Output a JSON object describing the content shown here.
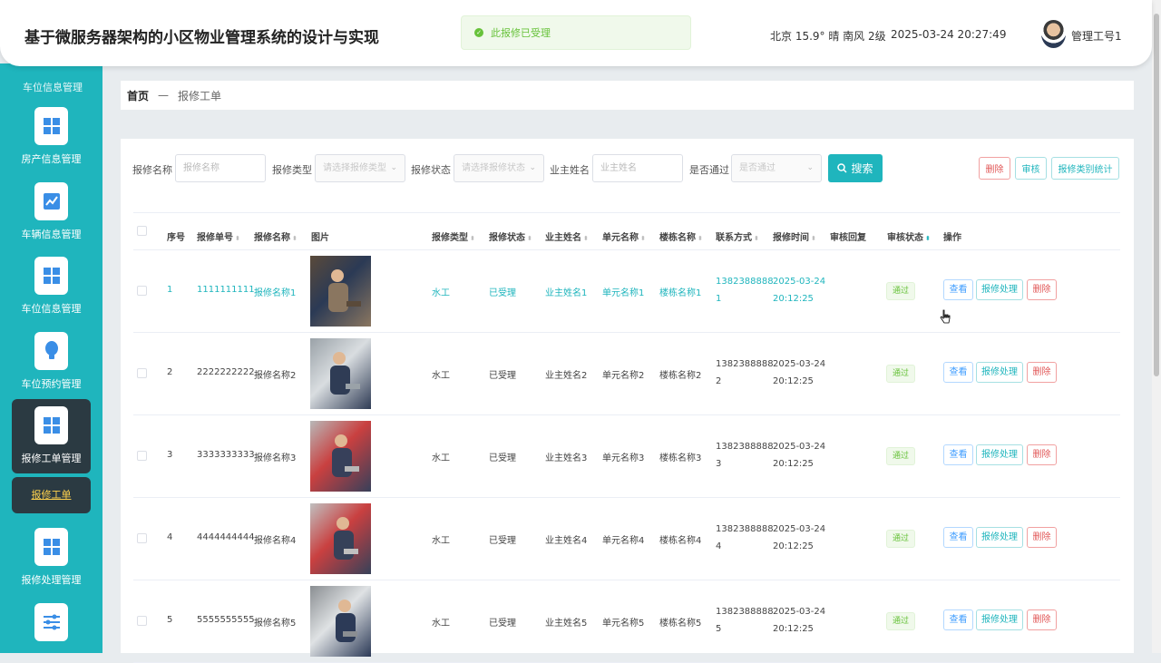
{
  "header": {
    "title": "基于微服务器架构的小区物业管理系统的设计与实现",
    "toast": "此报修已受理",
    "weather": "北京  15.9°  晴  南风  2级",
    "datetime": "2025-03-24 20:27:49",
    "user": "管理工号1"
  },
  "sidebar": {
    "clipped_label": "车位信息管理",
    "items": [
      {
        "label": "房产信息管理",
        "icon": "grid-icon"
      },
      {
        "label": "车辆信息管理",
        "icon": "chart-icon"
      },
      {
        "label": "车位信息管理",
        "icon": "grid-icon"
      },
      {
        "label": "车位预约管理",
        "icon": "bulb-icon"
      },
      {
        "label": "报修工单管理",
        "icon": "grid-icon"
      },
      {
        "label": "报修处理管理",
        "icon": "grid-icon"
      },
      {
        "label": "",
        "icon": "sliders-icon"
      }
    ],
    "sub_item": "报修工单"
  },
  "breadcrumb": {
    "home": "首页",
    "sep": "—",
    "current": "报修工单"
  },
  "filters": {
    "name_label": "报修名称",
    "name_placeholder": "报修名称",
    "type_label": "报修类型",
    "type_placeholder": "请选择报修类型",
    "status_label": "报修状态",
    "status_placeholder": "请选择报修状态",
    "owner_label": "业主姓名",
    "owner_placeholder": "业主姓名",
    "pass_label": "是否通过",
    "pass_placeholder": "是否通过",
    "search": "搜索",
    "delete": "删除",
    "audit": "审核",
    "stats": "报修类别统计"
  },
  "table": {
    "columns": [
      "序号",
      "报修单号",
      "报修名称",
      "图片",
      "报修类型",
      "报修状态",
      "业主姓名",
      "单元名称",
      "楼栋名称",
      "联系方式",
      "报修时间",
      "审核回复",
      "审核状态",
      "操作"
    ],
    "rows": [
      {
        "idx": "1",
        "no": "1111111111",
        "name": "报修名称1",
        "type": "水工",
        "status": "已受理",
        "owner": "业主姓名1",
        "unit": "单元名称1",
        "building": "楼栋名称1",
        "phone1": "1382388888",
        "phone2": "1",
        "date": "2025-03-24",
        "time": "20:12:25",
        "audit": "通过"
      },
      {
        "idx": "2",
        "no": "2222222222",
        "name": "报修名称2",
        "type": "水工",
        "status": "已受理",
        "owner": "业主姓名2",
        "unit": "单元名称2",
        "building": "楼栋名称2",
        "phone1": "1382388888",
        "phone2": "2",
        "date": "2025-03-24",
        "time": "20:12:25",
        "audit": "通过"
      },
      {
        "idx": "3",
        "no": "3333333333",
        "name": "报修名称3",
        "type": "水工",
        "status": "已受理",
        "owner": "业主姓名3",
        "unit": "单元名称3",
        "building": "楼栋名称3",
        "phone1": "1382388888",
        "phone2": "3",
        "date": "2025-03-24",
        "time": "20:12:25",
        "audit": "通过"
      },
      {
        "idx": "4",
        "no": "4444444444",
        "name": "报修名称4",
        "type": "水工",
        "status": "已受理",
        "owner": "业主姓名4",
        "unit": "单元名称4",
        "building": "楼栋名称4",
        "phone1": "1382388888",
        "phone2": "4",
        "date": "2025-03-24",
        "time": "20:12:25",
        "audit": "通过"
      },
      {
        "idx": "5",
        "no": "5555555555",
        "name": "报修名称5",
        "type": "水工",
        "status": "已受理",
        "owner": "业主姓名5",
        "unit": "单元名称5",
        "building": "楼栋名称5",
        "phone1": "1382388888",
        "phone2": "5",
        "date": "2025-03-24",
        "time": "20:12:25",
        "audit": "通过"
      }
    ],
    "actions": {
      "view": "查看",
      "process": "报修处理",
      "delete": "删除"
    }
  },
  "colors": {
    "accent": "#1fb5bd",
    "sidebar_active": "#2b3a42",
    "danger": "#e15656",
    "success": "#67c23a"
  }
}
